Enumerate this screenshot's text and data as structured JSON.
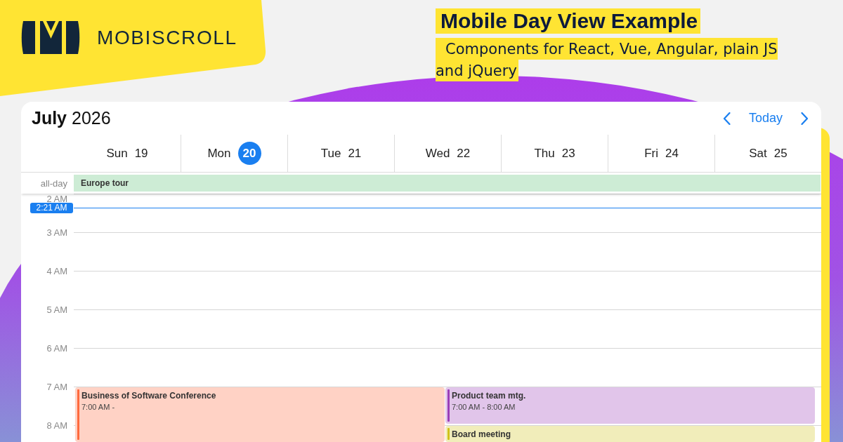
{
  "brand": {
    "name": "MOBISCROLL"
  },
  "heading": {
    "title": "Mobile Day View Example",
    "subtitle": "Components for React, Vue, Angular, plain JS and jQuery"
  },
  "calendar": {
    "title": "**July** 2026",
    "today_button": "Today",
    "days": [
      {
        "weekday": "Sun",
        "date": "19",
        "selected": false
      },
      {
        "weekday": "Mon",
        "date": "20",
        "selected": true
      },
      {
        "weekday": "Tue",
        "date": "21",
        "selected": false
      },
      {
        "weekday": "Wed",
        "date": "22",
        "selected": false
      },
      {
        "weekday": "Thu",
        "date": "23",
        "selected": false
      },
      {
        "weekday": "Fri",
        "date": "24",
        "selected": false
      },
      {
        "weekday": "Sat",
        "date": "25",
        "selected": false
      }
    ],
    "all_day": {
      "label": "all-day",
      "events": [
        {
          "title": "Europe tour"
        }
      ]
    },
    "hours": [
      {
        "label": "2 AM",
        "now": "2:21 AM"
      },
      {
        "label": "3 AM"
      },
      {
        "label": "4 AM"
      },
      {
        "label": "5 AM"
      },
      {
        "label": "6 AM"
      },
      {
        "label": "7 AM",
        "lanes": [
          {
            "events": [
              {
                "title": "Business of Software Conference",
                "time": "7:00 AM -",
                "color": "#ff6a3d"
              }
            ]
          },
          {
            "events": [
              {
                "title": "Product team mtg.",
                "time": "7:00 AM - 8:00 AM",
                "color": "#9b3db8"
              },
              {
                "title": "Board meeting",
                "color": "#d0c21a"
              }
            ]
          }
        ]
      },
      {
        "label": "8 AM"
      }
    ]
  }
}
